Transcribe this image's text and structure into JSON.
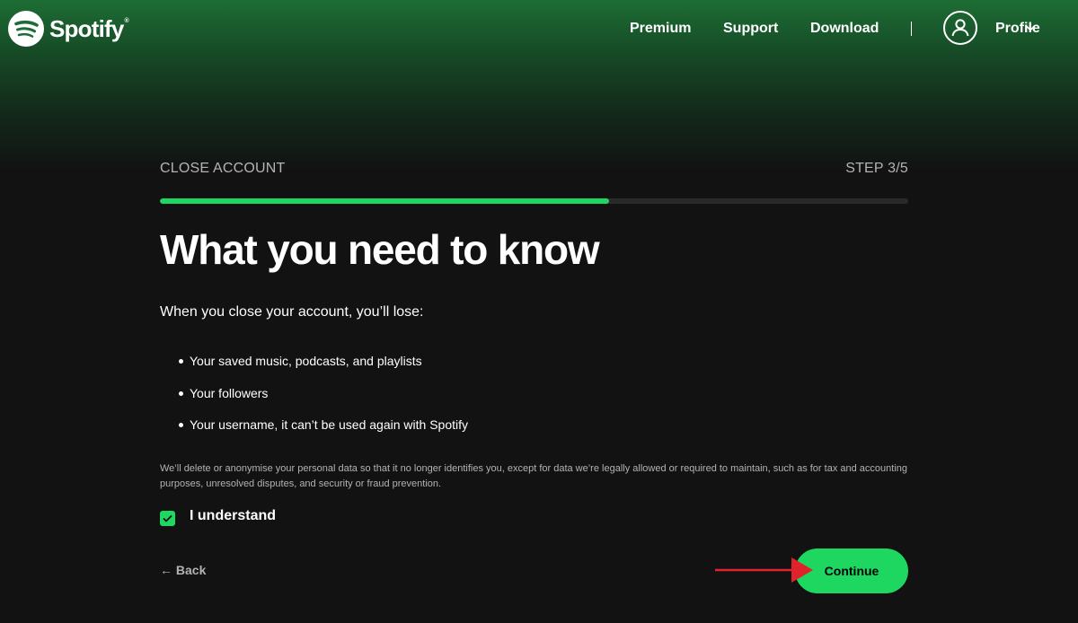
{
  "colors": {
    "accent": "#1ed760",
    "background": "#121212",
    "header_gradient_top": "#1d6d34",
    "muted_text": "#b3b3b3",
    "annotation_arrow": "#e0222b"
  },
  "header": {
    "logo_text": "Spotify",
    "logo_mark": "®",
    "nav": {
      "premium": "Premium",
      "support": "Support",
      "download": "Download"
    },
    "profile_label": "Profile",
    "icons": {
      "logo": "spotify-logo-icon",
      "profile": "user-icon",
      "dropdown": "chevron-down-icon"
    }
  },
  "close_account": {
    "section_label": "CLOSE ACCOUNT",
    "step_label": "STEP 3/5",
    "progress": 0.6,
    "title": "What you need to know",
    "intro": "When you close your account, you’ll lose:",
    "losses": [
      "Your saved music, podcasts, and playlists",
      "Your followers",
      "Your username, it can’t be used again with Spotify"
    ],
    "legal_text": "We’ll delete or anonymise your personal data so that it no longer identifies you, except for data we’re legally allowed or required to maintain, such as for tax and accounting purposes, unresolved disputes, and security or fraud prevention.",
    "checkbox": {
      "label": "I understand",
      "checked": true,
      "icon": "checkmark-icon"
    },
    "back_label": "← Back",
    "continue_label": "Continue"
  }
}
